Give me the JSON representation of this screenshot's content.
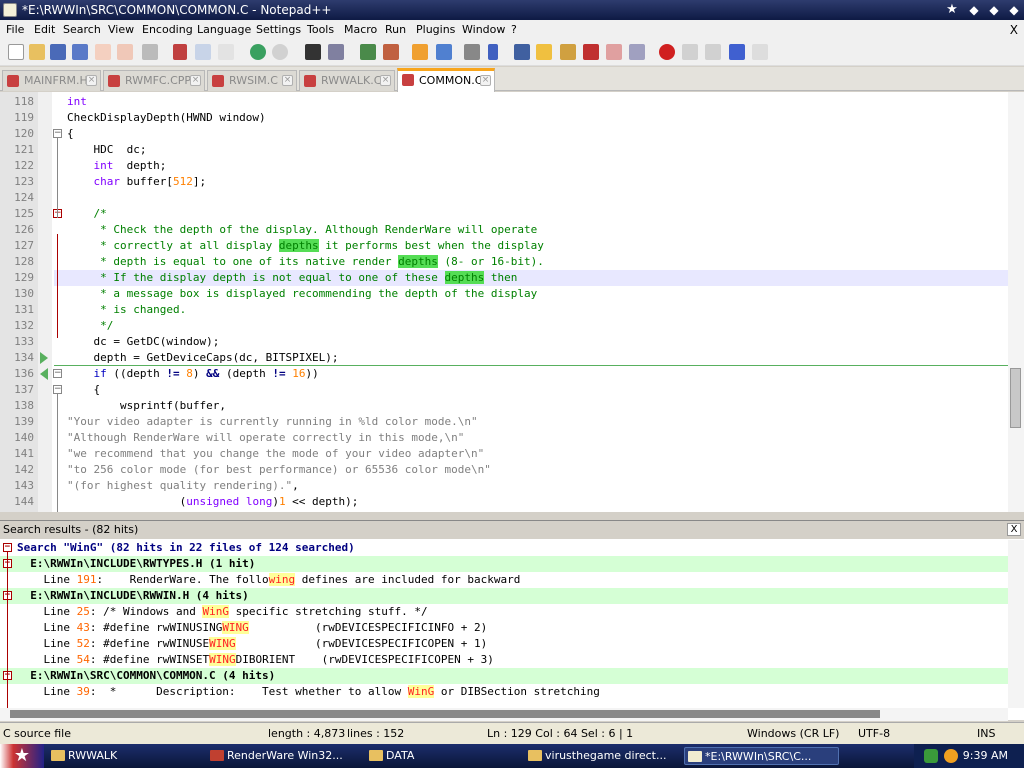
{
  "window": {
    "title": "*E:\\RWWIn\\SRC\\COMMON\\COMMON.C - Notepad++"
  },
  "menu": [
    "File",
    "Edit",
    "Search",
    "View",
    "Encoding",
    "Language",
    "Settings",
    "Tools",
    "Macro",
    "Run",
    "Plugins",
    "Window",
    "?"
  ],
  "menu_close": "X",
  "tabs": [
    {
      "label": "MAINFRM.H",
      "active": false
    },
    {
      "label": "RWMFC.CPP",
      "active": false
    },
    {
      "label": "RWSIM.C",
      "active": false
    },
    {
      "label": "RWWALK.C",
      "active": false
    },
    {
      "label": "COMMON.C",
      "active": true
    }
  ],
  "code_lines": [
    {
      "n": "118",
      "html": "<span class='ty'>int</span>"
    },
    {
      "n": "119",
      "html": "CheckDisplayDepth(HWND window)"
    },
    {
      "n": "120",
      "html": "{"
    },
    {
      "n": "121",
      "html": "    HDC  dc;"
    },
    {
      "n": "122",
      "html": "    <span class='ty'>int</span>  depth;"
    },
    {
      "n": "123",
      "html": "    <span class='ty'>char</span> buffer[<span class='num'>512</span>];"
    },
    {
      "n": "124",
      "html": ""
    },
    {
      "n": "125",
      "html": "    <span class='cm'>/*</span>"
    },
    {
      "n": "126",
      "html": "<span class='cm'>     * Check the depth of the display. Although RenderWare will operate</span>"
    },
    {
      "n": "127",
      "html": "<span class='cm'>     * correctly at all display <span class='hl'>depths</span> it performs best when the display</span>"
    },
    {
      "n": "128",
      "html": "<span class='cm'>     * depth is equal to one of its native render <span class='hl'>depths</span> (8- or 16-bit).</span>"
    },
    {
      "n": "129",
      "html": "<span class='cm'>     * If the display depth is not equal to one of these <span class='hl'>depths</span> then</span>"
    },
    {
      "n": "130",
      "html": "<span class='cm'>     * a message box is displayed recommending the depth of the display</span>"
    },
    {
      "n": "131",
      "html": "<span class='cm'>     * is changed.</span>"
    },
    {
      "n": "132",
      "html": "<span class='cm'>     */</span>"
    },
    {
      "n": "133",
      "html": "    dc = GetDC(window);"
    },
    {
      "n": "134",
      "html": "    depth = GetDeviceCaps(dc, BITSPIXEL);"
    },
    {
      "n": "136",
      "html": "    <span class='kw'>if</span> ((depth <span class='op'>!=</span> <span class='num'>8</span>) <span class='op'>&amp;&amp;</span> (depth <span class='op'>!=</span> <span class='num'>16</span>))"
    },
    {
      "n": "137",
      "html": "    {"
    },
    {
      "n": "138",
      "html": "        wsprintf(buffer,"
    },
    {
      "n": "139",
      "html": "<span class='str'>\"Your video adapter is currently running in %ld color mode.\\n\"</span>"
    },
    {
      "n": "140",
      "html": "<span class='str'>\"Although RenderWare will operate correctly in this mode,\\n\"</span>"
    },
    {
      "n": "141",
      "html": "<span class='str'>\"we recommend that you change the mode of your video adapter\\n\"</span>"
    },
    {
      "n": "142",
      "html": "<span class='str'>\"to 256 color mode (for best performance) or 65536 color mode\\n\"</span>"
    },
    {
      "n": "143",
      "html": "<span class='str'>\"(for highest quality rendering).\"</span>,"
    },
    {
      "n": "144",
      "html": "                 (<span class='ty'>unsigned long</span>)<span class='num'>1</span> &lt;&lt; depth);"
    }
  ],
  "results": {
    "header": "Search results - (82 hits)",
    "close": "X",
    "lines": [
      {
        "kind": "search",
        "html": "Search \"WinG\" (82 hits in 22 files of 124 searched)"
      },
      {
        "kind": "file",
        "html": "  E:\\RWWIn\\INCLUDE\\RWTYPES.H (1 hit)"
      },
      {
        "kind": "line",
        "html": "    Line <span class='lnum'>191</span>:    RenderWare. The follo<span class='hit'>wing</span> defines are included for backward"
      },
      {
        "kind": "file",
        "html": "  E:\\RWWIn\\INCLUDE\\RWWIN.H (4 hits)"
      },
      {
        "kind": "line",
        "html": "    Line <span class='lnum'>25</span>: /* Windows and <span class='hit'>WinG</span> specific stretching stuff. */"
      },
      {
        "kind": "line",
        "html": "    Line <span class='lnum'>43</span>: #define rwWINUSING<span class='hit'>WING</span>          (rwDEVICESPECIFICINFO + 2)"
      },
      {
        "kind": "line",
        "html": "    Line <span class='lnum'>52</span>: #define rwWINUSE<span class='hit'>WING</span>            (rwDEVICESPECIFICOPEN + 1)"
      },
      {
        "kind": "line",
        "html": "    Line <span class='lnum'>54</span>: #define rwWINSET<span class='hit'>WING</span>DIBORIENT    (rwDEVICESPECIFICOPEN + 3)"
      },
      {
        "kind": "file",
        "html": "  E:\\RWWIn\\SRC\\COMMON\\COMMON.C (4 hits)"
      },
      {
        "kind": "line",
        "html": "    Line <span class='lnum'>39</span>:  *      Description:    Test whether to allow <span class='hit'>WinG</span> or DIBSection stretching"
      }
    ]
  },
  "status": {
    "filetype": "C source file",
    "length": "length : 4,873",
    "lines": "lines : 152",
    "pos": "Ln : 129    Col : 64    Sel : 6 | 1",
    "eol": "Windows (CR LF)",
    "enc": "UTF-8",
    "mode": "INS"
  },
  "taskbar": {
    "tasks": [
      {
        "label": "RWWALK"
      },
      {
        "label": "RenderWare Win32..."
      },
      {
        "label": "DATA"
      },
      {
        "label": "virusthegame direct..."
      },
      {
        "label": "*E:\\RWWIn\\SRC\\C..."
      }
    ],
    "clock": "9:39 AM"
  }
}
